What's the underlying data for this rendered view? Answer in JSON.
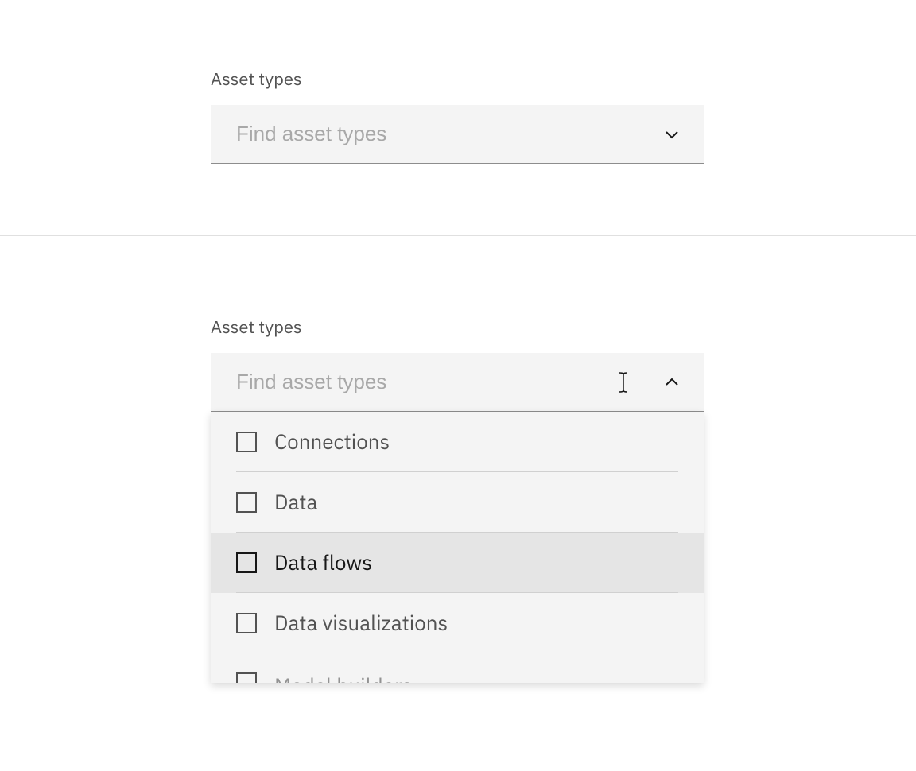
{
  "closed": {
    "label": "Asset types",
    "placeholder": "Find asset types"
  },
  "open": {
    "label": "Asset types",
    "placeholder": "Find asset types",
    "options": [
      {
        "label": "Connections",
        "checked": false,
        "hovered": false
      },
      {
        "label": "Data",
        "checked": false,
        "hovered": false
      },
      {
        "label": "Data flows",
        "checked": false,
        "hovered": true
      },
      {
        "label": "Data visualizations",
        "checked": false,
        "hovered": false
      },
      {
        "label": "Model builders",
        "checked": false,
        "hovered": false
      }
    ]
  }
}
